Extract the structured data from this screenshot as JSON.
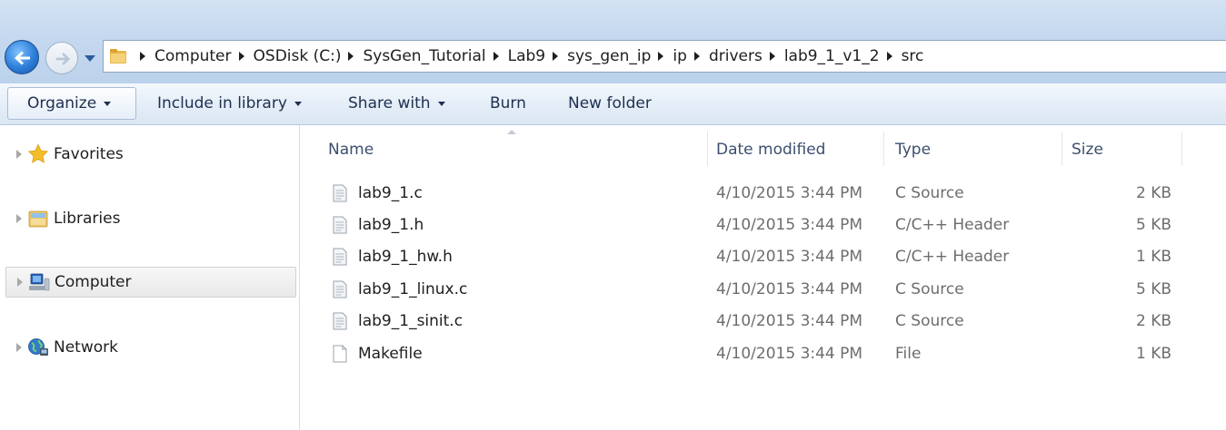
{
  "address": {
    "crumbs": [
      "Computer",
      "OSDisk (C:)",
      "SysGen_Tutorial",
      "Lab9",
      "sys_gen_ip",
      "ip",
      "drivers",
      "lab9_1_v1_2",
      "src"
    ]
  },
  "toolbar": {
    "organize_label": "Organize",
    "include_label": "Include in library",
    "share_label": "Share with",
    "burn_label": "Burn",
    "newfolder_label": "New folder"
  },
  "navigation": {
    "items": [
      {
        "label": "Favorites",
        "icon": "star-icon"
      },
      {
        "label": "Libraries",
        "icon": "library-icon"
      },
      {
        "label": "Computer",
        "icon": "computer-icon",
        "selected": true
      },
      {
        "label": "Network",
        "icon": "network-icon"
      }
    ]
  },
  "columns": {
    "name": "Name",
    "date": "Date modified",
    "type": "Type",
    "size": "Size"
  },
  "files": [
    {
      "name": "lab9_1.c",
      "date": "4/10/2015 3:44 PM",
      "type": "C Source",
      "size": "2 KB",
      "icon": "source-file-icon"
    },
    {
      "name": "lab9_1.h",
      "date": "4/10/2015 3:44 PM",
      "type": "C/C++ Header",
      "size": "5 KB",
      "icon": "source-file-icon"
    },
    {
      "name": "lab9_1_hw.h",
      "date": "4/10/2015 3:44 PM",
      "type": "C/C++ Header",
      "size": "1 KB",
      "icon": "source-file-icon"
    },
    {
      "name": "lab9_1_linux.c",
      "date": "4/10/2015 3:44 PM",
      "type": "C Source",
      "size": "5 KB",
      "icon": "source-file-icon"
    },
    {
      "name": "lab9_1_sinit.c",
      "date": "4/10/2015 3:44 PM",
      "type": "C Source",
      "size": "2 KB",
      "icon": "source-file-icon"
    },
    {
      "name": "Makefile",
      "date": "4/10/2015 3:44 PM",
      "type": "File",
      "size": "1 KB",
      "icon": "blank-file-icon"
    }
  ],
  "colors": {
    "titlebar": "#c5d8ef",
    "accent": "#2d7ed8",
    "header_text": "#3c4e6e",
    "secondary_text": "#6d6d6d"
  }
}
